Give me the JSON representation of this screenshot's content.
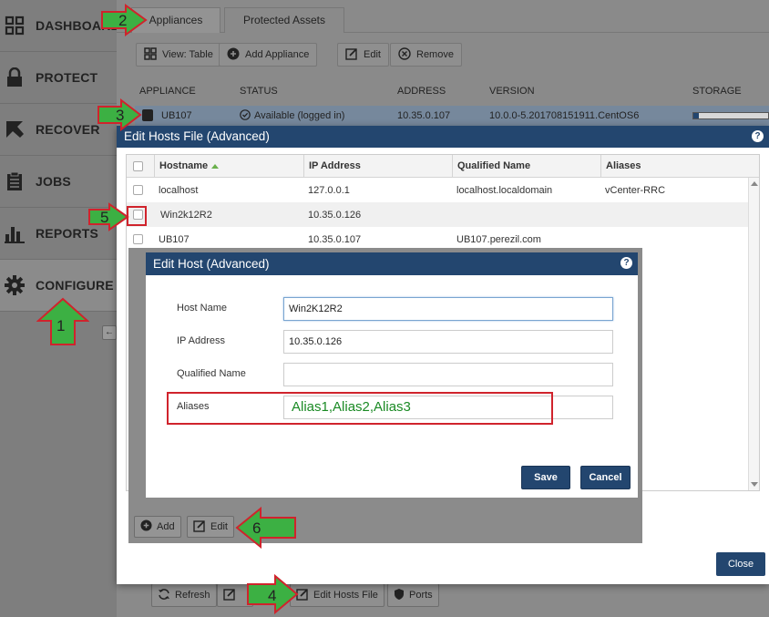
{
  "sidebar": {
    "items": [
      {
        "label": "DASHBOARD",
        "icon": "dashboard-grid-icon"
      },
      {
        "label": "PROTECT",
        "icon": "lock-icon"
      },
      {
        "label": "RECOVER",
        "icon": "recover-arrow-icon"
      },
      {
        "label": "JOBS",
        "icon": "clipboard-icon"
      },
      {
        "label": "REPORTS",
        "icon": "bar-chart-icon"
      },
      {
        "label": "CONFIGURE",
        "icon": "gear-icon"
      }
    ],
    "active": "CONFIGURE"
  },
  "tabs": {
    "appliances": "Appliances",
    "protected_assets": "Protected Assets"
  },
  "toolbar": {
    "view_table": "View: Table",
    "add_appliance": "Add Appliance",
    "edit": "Edit",
    "remove": "Remove"
  },
  "appliance_grid": {
    "columns": [
      "APPLIANCE",
      "STATUS",
      "ADDRESS",
      "VERSION",
      "STORAGE"
    ],
    "row": {
      "name": "UB107",
      "status": "Available (logged in)",
      "address": "10.35.0.107",
      "version": "10.0.0-5.201708151911.CentOS6"
    }
  },
  "hosts_dialog": {
    "title": "Edit Hosts File (Advanced)",
    "help": "?",
    "columns": {
      "hostname": "Hostname",
      "ip": "IP Address",
      "qualified": "Qualified Name",
      "aliases": "Aliases"
    },
    "rows": [
      {
        "hostname": "localhost",
        "ip": "127.0.0.1",
        "qualified": "localhost.localdomain",
        "aliases": "vCenter-RRC"
      },
      {
        "hostname": "Win2k12R2",
        "ip": "10.35.0.126",
        "qualified": "",
        "aliases": ""
      },
      {
        "hostname": "UB107",
        "ip": "10.35.0.107",
        "qualified": "UB107.perezil.com",
        "aliases": ""
      }
    ],
    "add": "Add",
    "edit": "Edit",
    "close": "Close"
  },
  "host_dialog": {
    "title": "Edit Host (Advanced)",
    "help": "?",
    "host_name_label": "Host Name",
    "host_name_value": "Win2K12R2",
    "ip_label": "IP Address",
    "ip_value": "10.35.0.126",
    "qualified_label": "Qualified Name",
    "qualified_value": "",
    "aliases_label": "Aliases",
    "aliases_value": "Alias1,Alias2,Alias3",
    "save": "Save",
    "cancel": "Cancel"
  },
  "bottom_toolbar": {
    "refresh": "Refresh",
    "edit_hosts_file": "Edit Hosts File",
    "ports": "Ports"
  },
  "annotations": {
    "n1": "1",
    "n2": "2",
    "n3": "3",
    "n4": "4",
    "n5": "5",
    "n6": "6"
  },
  "colors": {
    "arrow_fill": "#3cb043",
    "arrow_stroke": "#d0232c",
    "title_bar": "#23466f",
    "alias_text": "#1a8a24"
  }
}
